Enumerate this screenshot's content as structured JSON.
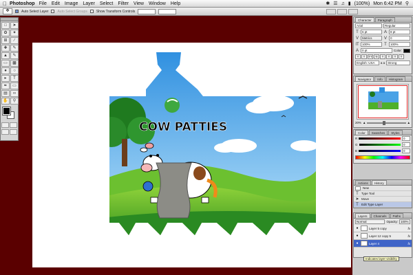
{
  "menubar": {
    "apple": "",
    "app": "Photoshop",
    "items": [
      "File",
      "Edit",
      "Image",
      "Layer",
      "Select",
      "Filter",
      "View",
      "Window",
      "Help"
    ],
    "battery": "(100%)",
    "clock": "Mon 6:42 PM"
  },
  "options": {
    "auto_select": "Auto Select Layer",
    "auto_select_groups": "Auto Select Groups",
    "show_transform": "Show Transform Controls"
  },
  "artwork": {
    "title": "COW PATTIES"
  },
  "character": {
    "tabs": [
      "Character",
      "Paragraph"
    ],
    "font_family": "Arial",
    "font_style": "Regular",
    "size": "6 pt",
    "leading": "8 pt",
    "kerning": "Metrics",
    "tracking": "0",
    "vert_scale": "100%",
    "horiz_scale": "100%",
    "baseline": "0 pt",
    "color_label": "Color:",
    "style_buttons": [
      "T",
      "T",
      "TT",
      "Tr",
      "T",
      "T",
      "T",
      "T"
    ],
    "language": "English: USA",
    "anti_alias": "Strong",
    "aa_label": "a a"
  },
  "navigator": {
    "tabs": [
      "Navigator",
      "Info",
      "Histogram"
    ],
    "zoom": "20%"
  },
  "color_panel": {
    "tabs": [
      "Color",
      "Swatches",
      "Styles"
    ],
    "r_label": "R",
    "g_label": "G",
    "b_label": "B",
    "r": "0",
    "g": "0",
    "b": "0"
  },
  "history": {
    "tabs": [
      "Actions",
      "History"
    ],
    "items": [
      "New",
      "Type Tool",
      "Move",
      "Edit Type Layer"
    ]
  },
  "layers": {
    "tabs": [
      "Layers",
      "Channels",
      "Paths"
    ],
    "blend": "Normal",
    "opacity_label": "Opacity:",
    "opacity": "100%",
    "items": [
      {
        "name": "Layer 5 copy"
      },
      {
        "name": "Layer 12 copy 5"
      },
      {
        "name": "Layer 4"
      }
    ],
    "fx": "fx"
  },
  "tooltip": "Indicates layer visibility",
  "colors": {
    "pasteboard": "#5a0000",
    "selected_layer": "#3f64c8"
  }
}
